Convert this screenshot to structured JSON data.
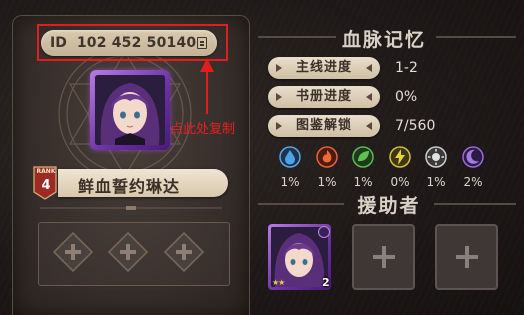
{
  "profile": {
    "id_label": "ID",
    "id_number": "102 452 50140",
    "copy_hint": "点此处复制",
    "hero_name": "鲜血誓约琳达",
    "rank_label": "RANK",
    "rank_value": "4"
  },
  "bloodline_memory": {
    "title": "血脉记忆",
    "stats": [
      {
        "label": "主线进度",
        "value": "1-2"
      },
      {
        "label": "书册进度",
        "value": "0%"
      },
      {
        "label": "图鉴解锁",
        "value": "7/560"
      }
    ],
    "elements": [
      {
        "icon": "water-element-icon",
        "color": "#3f8fd8",
        "percent": "1%"
      },
      {
        "icon": "fire-element-icon",
        "color": "#e0502c",
        "percent": "1%"
      },
      {
        "icon": "wind-element-icon",
        "color": "#4cae46",
        "percent": "1%"
      },
      {
        "icon": "thunder-element-icon",
        "color": "#c9b32a",
        "percent": "0%"
      },
      {
        "icon": "light-element-icon",
        "color": "#b9b9b9",
        "percent": "1%"
      },
      {
        "icon": "dark-element-icon",
        "color": "#8a5cc8",
        "percent": "2%"
      }
    ]
  },
  "helpers": {
    "title": "援助者",
    "first_level": "2",
    "first_stars": "★★"
  },
  "colors": {
    "highlight_red": "#e11d1d",
    "parchment": "#d9cab0",
    "avatar_frame": "#8a4ac4"
  }
}
